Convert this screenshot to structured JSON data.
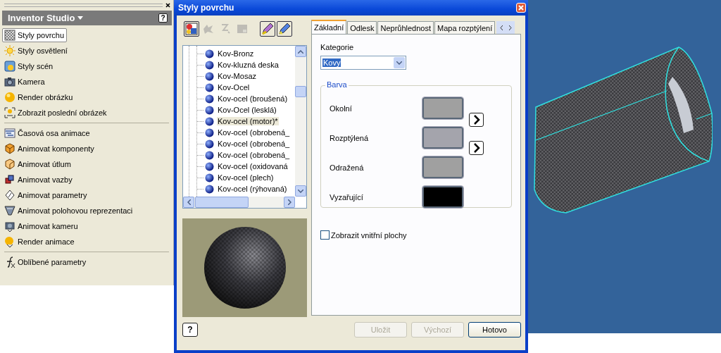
{
  "panel": {
    "title": "Inventor Studio",
    "help_icon": "?",
    "sections": [
      [
        {
          "label": "Styly povrchu",
          "selected": true
        },
        {
          "label": "Styly osvětlení",
          "selected": false
        },
        {
          "label": "Styly scén",
          "selected": false
        },
        {
          "label": "Kamera",
          "selected": false
        },
        {
          "label": "Render obrázku",
          "selected": false
        },
        {
          "label": "Zobrazit poslední obrázek",
          "selected": false
        }
      ],
      [
        {
          "label": "Časová osa animace",
          "selected": false
        },
        {
          "label": "Animovat komponenty",
          "selected": false
        },
        {
          "label": "Animovat útlum",
          "selected": false
        },
        {
          "label": "Animovat vazby",
          "selected": false
        },
        {
          "label": "Animovat parametry",
          "selected": false
        },
        {
          "label": "Animovat polohovou reprezentaci",
          "selected": false
        },
        {
          "label": "Animovat kameru",
          "selected": false
        },
        {
          "label": "Render animace",
          "selected": false
        }
      ],
      [
        {
          "label": "Oblíbené parametry",
          "selected": false
        }
      ]
    ]
  },
  "dialog": {
    "title": "Styly povrchu",
    "toolbar": [
      {
        "disabled": false
      },
      {
        "disabled": true
      },
      {
        "disabled": true
      },
      {
        "disabled": true
      },
      {
        "disabled": false
      },
      {
        "disabled": false
      }
    ],
    "tree": [
      {
        "label": "Kov-Bronz",
        "selected": false
      },
      {
        "label": "Kov-kluzná deska",
        "selected": false
      },
      {
        "label": "Kov-Mosaz",
        "selected": false
      },
      {
        "label": "Kov-Ocel",
        "selected": false
      },
      {
        "label": "Kov-ocel (broušená)",
        "selected": false
      },
      {
        "label": "Kov-Ocel (lesklá)",
        "selected": false
      },
      {
        "label": "Kov-ocel (motor)*",
        "selected": true
      },
      {
        "label": "Kov-ocel (obrobená_",
        "selected": false
      },
      {
        "label": "Kov-ocel (obrobená_",
        "selected": false
      },
      {
        "label": "Kov-ocel (obrobená_",
        "selected": false
      },
      {
        "label": "Kov-ocel (oxidovaná",
        "selected": false
      },
      {
        "label": "Kov-ocel (plech)",
        "selected": false
      },
      {
        "label": "Kov-ocel (rýhovaná)",
        "selected": false
      }
    ],
    "tabs": [
      {
        "label": "Základní",
        "selected": true
      },
      {
        "label": "Odlesk",
        "selected": false
      },
      {
        "label": "Neprůhlednost",
        "selected": false
      },
      {
        "label": "Mapa rozptýlení",
        "selected": false
      }
    ],
    "category": {
      "label": "Kategorie",
      "value": "Kovy"
    },
    "color_group": {
      "title": "Barva",
      "rows": [
        {
          "label": "Okolní",
          "color": "#a0a0a0"
        },
        {
          "label": "Rozptýlená",
          "color": "#a4a4ac"
        },
        {
          "label": "Odražená",
          "color": "#a0a0a0"
        },
        {
          "label": "Vyzařující",
          "color": "#000000"
        }
      ]
    },
    "show_inner": {
      "label": "Zobrazit vnitřní plochy",
      "checked": false
    },
    "help_button": "?",
    "buttons": [
      {
        "label": "Uložit",
        "disabled": true
      },
      {
        "label": "Výchozí",
        "disabled": true
      },
      {
        "label": "Hotovo",
        "disabled": false
      }
    ]
  }
}
